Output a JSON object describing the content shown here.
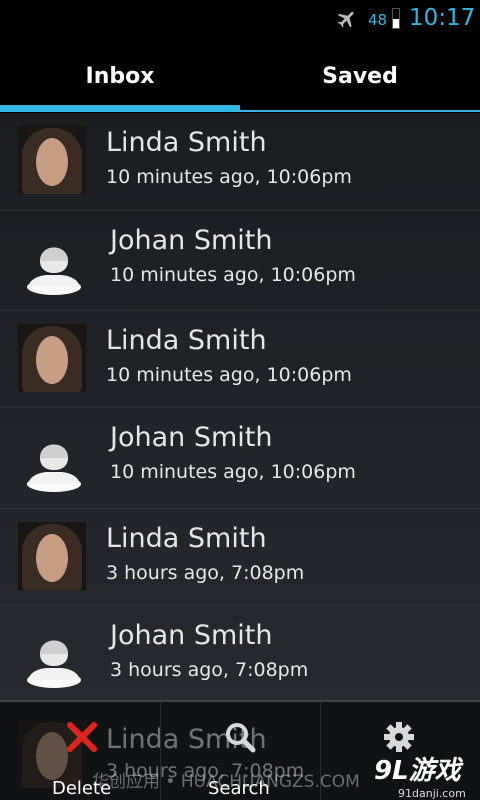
{
  "status_bar": {
    "battery_level": "48",
    "time": "10:17",
    "icons": [
      "airplane-icon",
      "battery-icon"
    ],
    "accent_color": "#33b5e5"
  },
  "tabs": [
    {
      "label": "Inbox",
      "selected": true
    },
    {
      "label": "Saved",
      "selected": false
    }
  ],
  "list": {
    "items": [
      {
        "name": "Linda Smith",
        "time": "10 minutes ago, 10:06pm",
        "avatar": "photo"
      },
      {
        "name": "Johan Smith",
        "time": "10 minutes ago, 10:06pm",
        "avatar": "default-contact-icon"
      },
      {
        "name": "Linda Smith",
        "time": "10 minutes ago, 10:06pm",
        "avatar": "photo"
      },
      {
        "name": "Johan Smith",
        "time": "10 minutes ago, 10:06pm",
        "avatar": "default-contact-icon"
      },
      {
        "name": "Linda Smith",
        "time": "3 hours ago, 7:08pm",
        "avatar": "photo"
      },
      {
        "name": "Johan Smith",
        "time": "3 hours ago, 7:08pm",
        "avatar": "default-contact-icon"
      }
    ],
    "partial_item": {
      "name": "Linda Smith",
      "time": "3 hours ago, 7:08pm"
    }
  },
  "bottom_bar": {
    "delete_label": "Delete",
    "search_label": "Search",
    "settings_label": "",
    "icons": [
      "delete-icon",
      "search-icon",
      "settings-icon"
    ]
  },
  "watermark": {
    "text": "华创应用 • HUACHUANGZS.COM",
    "brand": "9L游戏",
    "brand_sub": "91danji.com"
  }
}
